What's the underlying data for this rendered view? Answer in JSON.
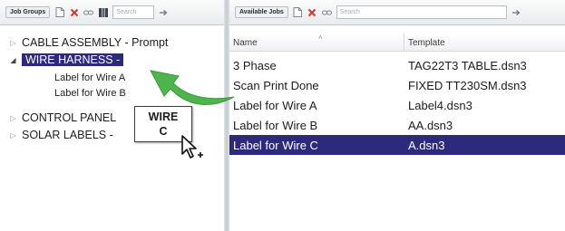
{
  "left_panel": {
    "toolbar": {
      "title": "Job Groups",
      "search_placeholder": "Search"
    },
    "tree": [
      {
        "label": "CABLE ASSEMBLY - Prompt",
        "expanded": false,
        "selected": false,
        "children": []
      },
      {
        "label": "WIRE HARNESS -",
        "expanded": true,
        "selected": true,
        "children": [
          "Label for Wire A",
          "Label for Wire B"
        ]
      },
      {
        "label": "CONTROL PANEL",
        "expanded": false,
        "selected": false,
        "children": []
      },
      {
        "label": "SOLAR LABELS -",
        "expanded": false,
        "selected": false,
        "children": []
      }
    ]
  },
  "drag_tooltip": {
    "line1": "WIRE",
    "line2": "C"
  },
  "right_panel": {
    "toolbar": {
      "title": "Available Jobs",
      "search_placeholder": "Search"
    },
    "columns": [
      "Name",
      "Template"
    ],
    "rows": [
      {
        "name": "3 Phase",
        "template": "TAG22T3 TABLE.dsn3",
        "selected": false
      },
      {
        "name": "Scan Print Done",
        "template": "FIXED TT230SM.dsn3",
        "selected": false
      },
      {
        "name": "Label for Wire A",
        "template": "Label4.dsn3",
        "selected": false
      },
      {
        "name": "Label for Wire B",
        "template": "AA.dsn3",
        "selected": false
      },
      {
        "name": "Label for Wire C",
        "template": "A.dsn3",
        "selected": true
      }
    ]
  },
  "colors": {
    "selection": "#2d2a7e",
    "drag_arrow": "#3fae3f",
    "delete_icon": "#d9342b"
  },
  "icons": [
    "new-item-icon",
    "delete-icon",
    "link-icon",
    "columns-icon",
    "search-go-icon",
    "expand-icon",
    "collapse-icon",
    "drag-cursor-icon"
  ]
}
